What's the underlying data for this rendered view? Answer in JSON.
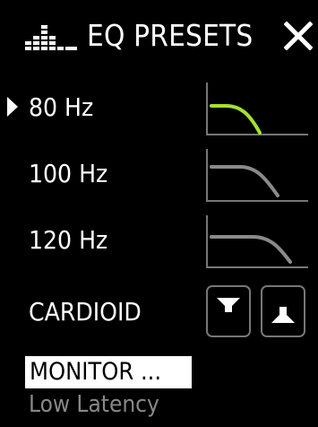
{
  "header": {
    "title": "EQ PRESETS",
    "icon": "equalizer-icon",
    "close_icon": "close-icon"
  },
  "presets": [
    {
      "label": "80 Hz",
      "selected": true,
      "curve_color": "#a5e02f"
    },
    {
      "label": "100 Hz",
      "selected": false,
      "curve_color": "#8a8a8a"
    },
    {
      "label": "120 Hz",
      "selected": false,
      "curve_color": "#8a8a8a"
    }
  ],
  "cardioid": {
    "label": "CARDIOID",
    "options": [
      "cardioid-narrow-icon",
      "cardioid-wide-icon"
    ]
  },
  "monitor": {
    "label": "MONITOR ...",
    "value": "Low Latency"
  },
  "colors": {
    "background": "#000000",
    "accent": "#a5e02f",
    "inactive": "#8a8a8a"
  }
}
